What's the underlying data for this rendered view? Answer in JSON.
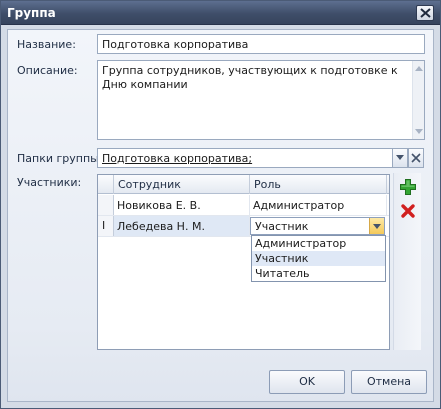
{
  "window": {
    "title": "Группа"
  },
  "form": {
    "name_label": "Название:",
    "name_value": "Подготовка корпоратива",
    "description_label": "Описание:",
    "description_value": "Группа сотрудников, участвующих к подготовке к Дню компании",
    "folders_label": "Папки группы:",
    "folders_value": "Подготовка корпоратива;",
    "participants_label": "Участники:"
  },
  "grid": {
    "columns": [
      "Сотрудник",
      "Роль"
    ],
    "rows": [
      {
        "employee": "Новикова Е. В.",
        "role": "Администратор"
      },
      {
        "employee": "Лебедева Н. М.",
        "role": "Участник"
      }
    ],
    "edit_indicator": "I"
  },
  "role_dropdown": {
    "options": [
      "Администратор",
      "Участник",
      "Читатель"
    ],
    "selected": "Участник"
  },
  "buttons": {
    "ok": "OK",
    "cancel": "Отмена"
  },
  "icons": {
    "add": "add-icon",
    "delete": "delete-icon",
    "close": "close-icon",
    "dropdown": "chevron-down-icon",
    "clear": "clear-icon"
  },
  "colors": {
    "titlebar": "#3f4e69",
    "add_green": "#2e9a2e",
    "delete_red": "#d11f1f",
    "combo_button": "#f4c95a",
    "selection": "#dfe8f6"
  }
}
